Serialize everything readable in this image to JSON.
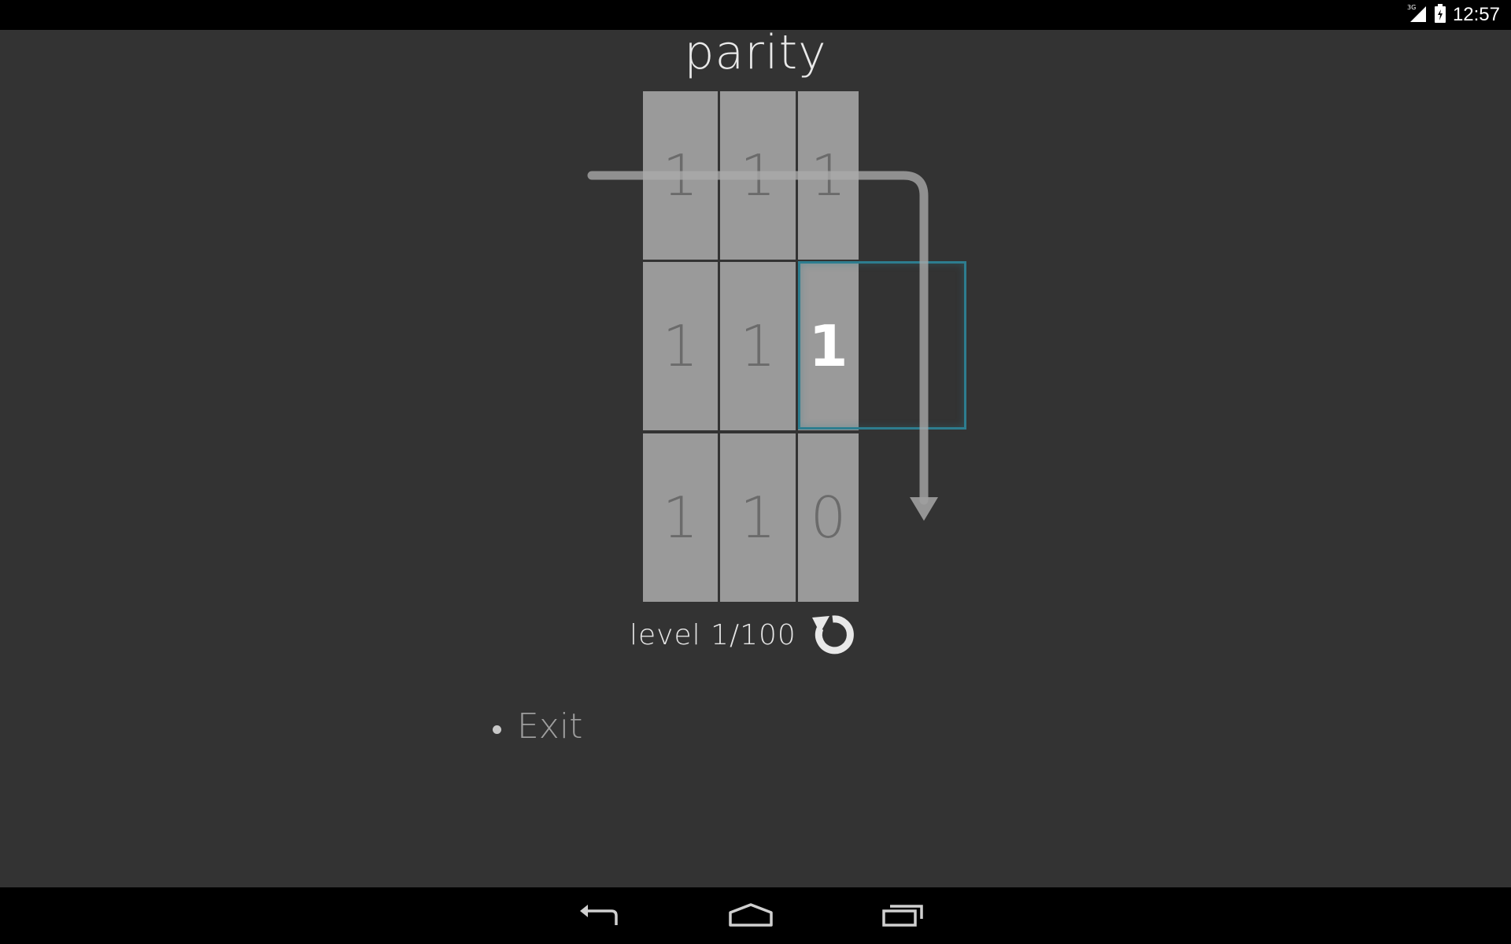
{
  "app": {
    "title": "parity"
  },
  "status_bar": {
    "network": "3G",
    "time": "12:57"
  },
  "board": {
    "rows": [
      [
        "1",
        "1",
        "1"
      ],
      [
        "1",
        "1",
        "1"
      ],
      [
        "1",
        "1",
        "0"
      ]
    ],
    "active_cell": "1"
  },
  "level": {
    "text": "level 1/100"
  },
  "menu": {
    "exit_label": "Exit"
  },
  "colors": {
    "background": "#333333",
    "cell": "#9a9a9a",
    "cell_text": "#6b6b6b",
    "selection": "#2d7d8f",
    "path": "#8c8c8c"
  },
  "icons": {
    "restart": "restart-icon",
    "back": "back-icon",
    "home": "home-icon",
    "recents": "recents-icon",
    "signal": "signal-icon",
    "battery": "battery-icon"
  }
}
